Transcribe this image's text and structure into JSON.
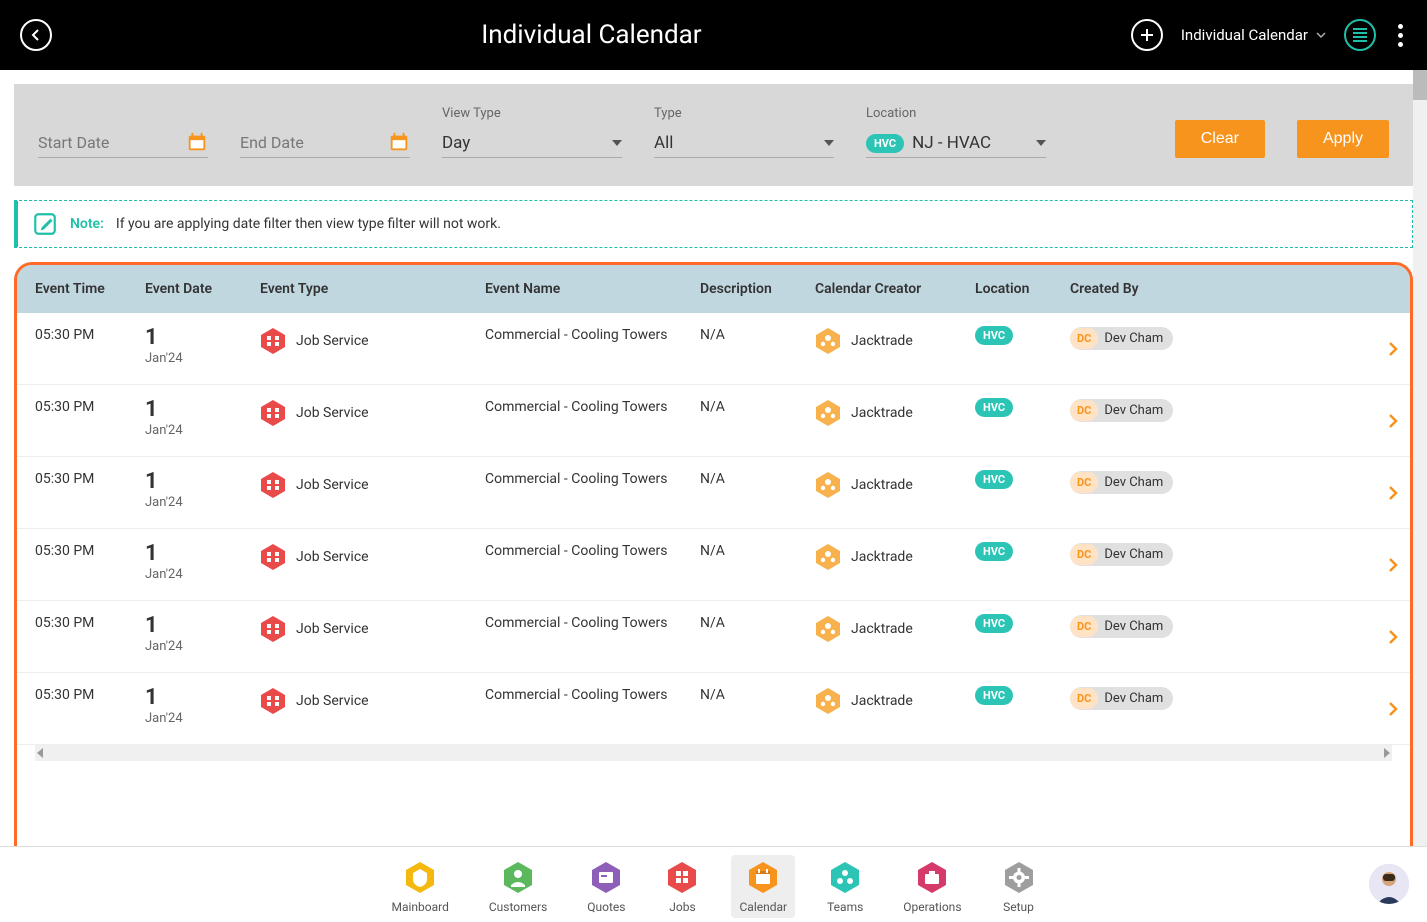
{
  "header": {
    "title": "Individual Calendar",
    "view_selector": "Individual Calendar"
  },
  "filters": {
    "start_date_placeholder": "Start Date",
    "end_date_placeholder": "End Date",
    "view_type_label": "View Type",
    "view_type_value": "Day",
    "type_label": "Type",
    "type_value": "All",
    "location_label": "Location",
    "location_badge": "HVC",
    "location_value": "NJ - HVAC",
    "clear_label": "Clear",
    "apply_label": "Apply"
  },
  "note": {
    "label": "Note:",
    "text": "If you are applying date filter then view type filter will not work."
  },
  "table": {
    "headers": {
      "time": "Event Time",
      "date": "Event Date",
      "type": "Event Type",
      "name": "Event Name",
      "desc": "Description",
      "creator": "Calendar Creator",
      "loc": "Location",
      "by": "Created By"
    },
    "rows": [
      {
        "time": "05:30 PM",
        "date_day": "1",
        "date_sub": "Jan'24",
        "type": "Job Service",
        "name": "Commercial - Cooling Towers",
        "desc": "N/A",
        "creator": "Jacktrade",
        "loc": "HVC",
        "by_initials": "DC",
        "by_name": "Dev Cham"
      },
      {
        "time": "05:30 PM",
        "date_day": "1",
        "date_sub": "Jan'24",
        "type": "Job Service",
        "name": "Commercial - Cooling Towers",
        "desc": "N/A",
        "creator": "Jacktrade",
        "loc": "HVC",
        "by_initials": "DC",
        "by_name": "Dev Cham"
      },
      {
        "time": "05:30 PM",
        "date_day": "1",
        "date_sub": "Jan'24",
        "type": "Job Service",
        "name": "Commercial - Cooling Towers",
        "desc": "N/A",
        "creator": "Jacktrade",
        "loc": "HVC",
        "by_initials": "DC",
        "by_name": "Dev Cham"
      },
      {
        "time": "05:30 PM",
        "date_day": "1",
        "date_sub": "Jan'24",
        "type": "Job Service",
        "name": "Commercial - Cooling Towers",
        "desc": "N/A",
        "creator": "Jacktrade",
        "loc": "HVC",
        "by_initials": "DC",
        "by_name": "Dev Cham"
      },
      {
        "time": "05:30 PM",
        "date_day": "1",
        "date_sub": "Jan'24",
        "type": "Job Service",
        "name": "Commercial - Cooling Towers",
        "desc": "N/A",
        "creator": "Jacktrade",
        "loc": "HVC",
        "by_initials": "DC",
        "by_name": "Dev Cham"
      },
      {
        "time": "05:30 PM",
        "date_day": "1",
        "date_sub": "Jan'24",
        "type": "Job Service",
        "name": "Commercial - Cooling Towers",
        "desc": "N/A",
        "creator": "Jacktrade",
        "loc": "HVC",
        "by_initials": "DC",
        "by_name": "Dev Cham"
      }
    ]
  },
  "nav": {
    "items": [
      {
        "label": "Mainboard",
        "color": "#f5b80f",
        "icon": "shield"
      },
      {
        "label": "Customers",
        "color": "#5cb85c",
        "icon": "user"
      },
      {
        "label": "Quotes",
        "color": "#8e5fb9",
        "icon": "card"
      },
      {
        "label": "Jobs",
        "color": "#e94b4b",
        "icon": "grid"
      },
      {
        "label": "Calendar",
        "color": "#f7941d",
        "icon": "calendar",
        "active": true
      },
      {
        "label": "Teams",
        "color": "#2cc4b5",
        "icon": "dots"
      },
      {
        "label": "Operations",
        "color": "#d63a6a",
        "icon": "briefcase"
      },
      {
        "label": "Setup",
        "color": "#9e9e9e",
        "icon": "gear"
      }
    ]
  }
}
